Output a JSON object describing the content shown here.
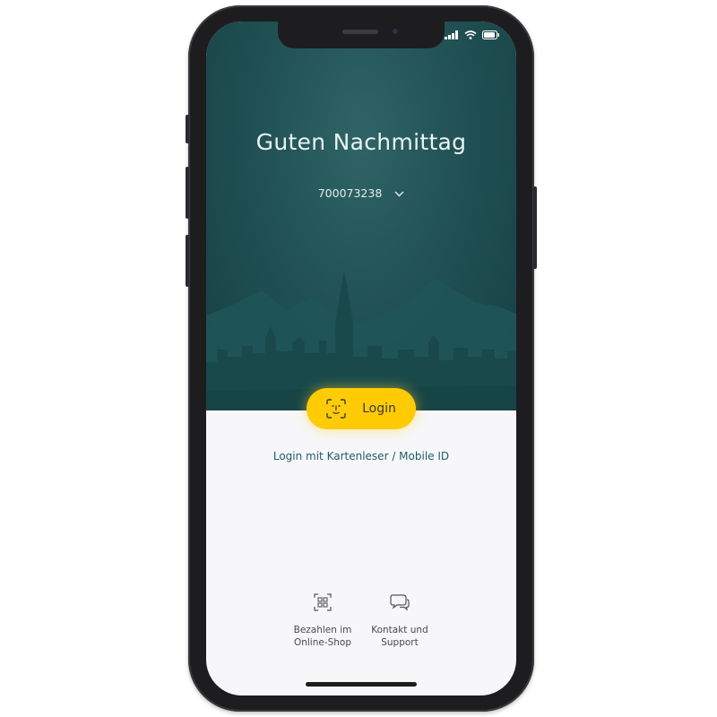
{
  "greeting": "Guten Nachmittag",
  "account": {
    "number": "700073238",
    "chevron_icon": "chevron-down-icon"
  },
  "login_button": {
    "label": "Login",
    "icon": "face-id-icon",
    "color": "#ffcb05"
  },
  "alt_login_label": "Login mit Kartenleser / Mobile ID",
  "shortcuts": [
    {
      "line1": "Bezahlen im",
      "line2": "Online-Shop",
      "icon": "qr-code-icon"
    },
    {
      "line1": "Kontakt und",
      "line2": "Support",
      "icon": "chat-bubbles-icon"
    }
  ],
  "colors": {
    "hero": "#215255",
    "accent": "#ffcb05",
    "link": "#1f5e64"
  }
}
